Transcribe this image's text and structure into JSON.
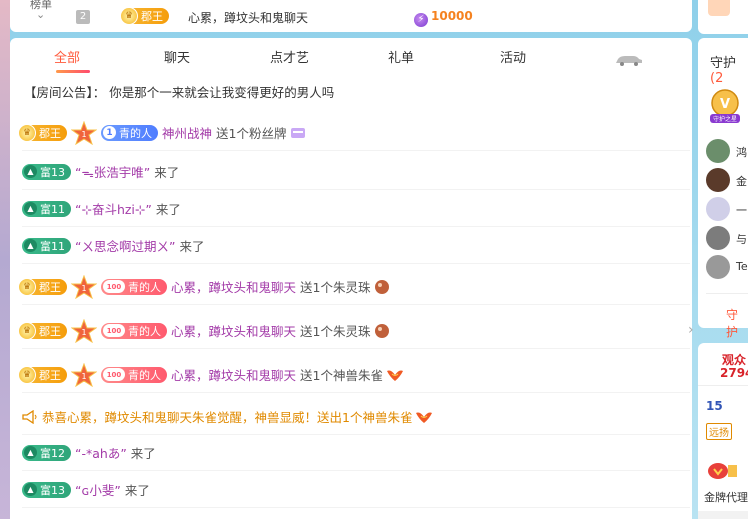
{
  "top": {
    "rank_label": "榜单",
    "rank_num": "2",
    "king_label": "郡王",
    "user": "心累，蹲坟头和鬼聊天",
    "score": "10000"
  },
  "tabs": [
    "全部",
    "聊天",
    "点才艺",
    "礼单",
    "活动"
  ],
  "notice": "【房间公告】：  你是那个一来就会让我变得更好的男人吗",
  "messages": [
    {
      "type": "gift",
      "king": "郡王",
      "fans_level": "1",
      "fans_name": "青的人",
      "user": "神州战神",
      "text": "送1个粉丝牌"
    },
    {
      "type": "enter",
      "fu": "富13",
      "user": "“ᯓ张浩宇唯”",
      "text": "来了"
    },
    {
      "type": "enter",
      "fu": "富11",
      "user": "“⊹奋斗hzi⊹”",
      "text": "来了"
    },
    {
      "type": "enter",
      "fu": "富11",
      "user": "“ㄨ思念啊过期ㄨ”",
      "text": "来了"
    },
    {
      "type": "gift",
      "king": "郡王",
      "fans_level": "100",
      "fans_name": "青的人",
      "user": "心累，蹲坟头和鬼聊天",
      "text": "送1个朱灵珠"
    },
    {
      "type": "gift",
      "king": "郡王",
      "fans_level": "100",
      "fans_name": "青的人",
      "user": "心累，蹲坟头和鬼聊天",
      "text": "送1个朱灵珠"
    },
    {
      "type": "gift",
      "king": "郡王",
      "fans_level": "100",
      "fans_name": "青的人",
      "user": "心累，蹲坟头和鬼聊天",
      "text": "送1个神兽朱雀"
    },
    {
      "type": "system",
      "text": "恭喜心累，蹲坟头和鬼聊天朱雀觉醒，神兽显威！送出1个神兽朱雀"
    },
    {
      "type": "enter",
      "fu": "富12",
      "user": "“-*ahあ”",
      "text": "来了"
    },
    {
      "type": "enter",
      "fu": "富13",
      "user": "“ɢ小斐”",
      "text": "来了"
    }
  ],
  "right": {
    "guard_title": "守护",
    "guard_count": "(2",
    "guard_badge": "守护之星",
    "guards": [
      "鸿",
      "金",
      "一",
      "与",
      "Teu"
    ],
    "guard_more": "守护",
    "audience_title": "观众",
    "audience_count": "2794",
    "level": "15",
    "yuan_tag": "远扬",
    "gold_label": "金牌代理"
  },
  "colors": {
    "accent": "#ff5a3c",
    "name": "#a33ba8",
    "system": "#e08a00",
    "score": "#f5821f"
  }
}
